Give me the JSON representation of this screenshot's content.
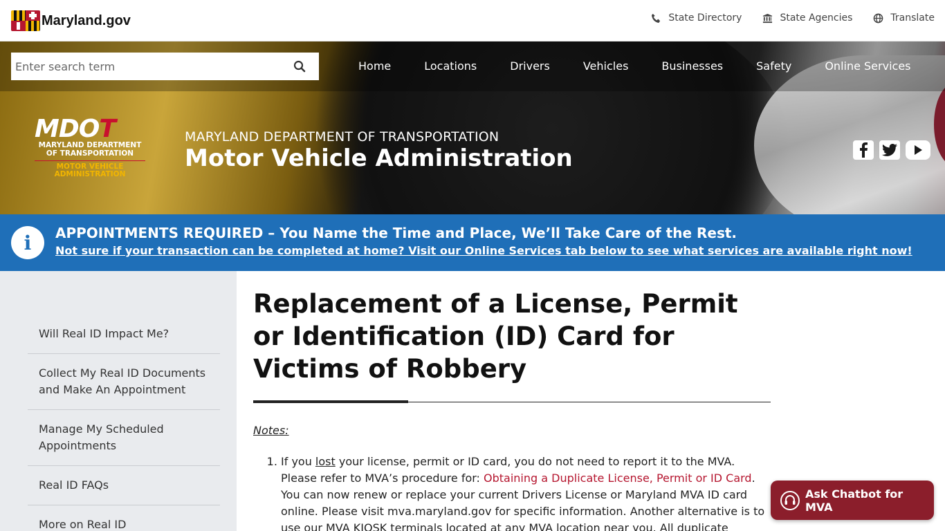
{
  "site": {
    "brand": "Maryland.gov",
    "utility": [
      {
        "label": "State Directory",
        "icon": "phone-icon"
      },
      {
        "label": "State Agencies",
        "icon": "building-icon"
      },
      {
        "label": "Translate",
        "icon": "globe-icon"
      }
    ]
  },
  "search": {
    "placeholder": "Enter search term"
  },
  "nav": [
    {
      "label": "Home"
    },
    {
      "label": "Locations"
    },
    {
      "label": "Drivers"
    },
    {
      "label": "Vehicles"
    },
    {
      "label": "Businesses"
    },
    {
      "label": "Safety"
    },
    {
      "label": "Online Services"
    }
  ],
  "mdot_logo": {
    "mark": "MDOT",
    "line1": "MARYLAND DEPARTMENT",
    "line2": "OF TRANSPORTATION",
    "line3": "MOTOR VEHICLE",
    "line4": "ADMINISTRATION"
  },
  "agency": {
    "department": "MARYLAND DEPARTMENT OF TRANSPORTATION",
    "administration": "Motor Vehicle Administration"
  },
  "social": [
    {
      "icon": "facebook-icon"
    },
    {
      "icon": "twitter-icon"
    },
    {
      "icon": "youtube-icon"
    }
  ],
  "alert": {
    "title": "APPOINTMENTS REQUIRED – You Name the Time and Place, We’ll Take Care of the Rest.",
    "link": "Not sure if your transaction can be completed at home? Visit our Online Services tab below to see what services are available right now!"
  },
  "sidebar": {
    "items": [
      {
        "label": "Will Real ID Impact Me?"
      },
      {
        "label": "Collect My Real ID Documents and Make An Appointment"
      },
      {
        "label": "Manage My Scheduled Appointments"
      },
      {
        "label": "Real ID FAQs"
      },
      {
        "label": "More on Real ID"
      }
    ]
  },
  "content": {
    "title": "Replacement of a License, Permit or Identification (ID) Card for Victims of Robbery",
    "notes_label": "Notes:",
    "note1": {
      "pre": "If you ",
      "underlined": "lost",
      "mid": " your license, permit or ID card, you do not need to report it to the MVA. Please refer to MVA’s procedure for: ",
      "link": "Obtaining a Duplicate License, Permit or ID Card",
      "post": ". You can now renew or replace your current Drivers License or Maryland MVA ID card online. Please visit mva.maryland.gov for specific information. Another alternative is to use our MVA KIOSK terminals located at any MVA location near you. All duplicate noncommercial"
    }
  },
  "chatbot": {
    "label": "Ask Chatbot for MVA"
  },
  "colors": {
    "alert_blue": "#1f6fb8",
    "chatbot_maroon": "#8b1e2b",
    "link_red": "#b5162f",
    "sidebar_bg": "#e9ebee"
  }
}
